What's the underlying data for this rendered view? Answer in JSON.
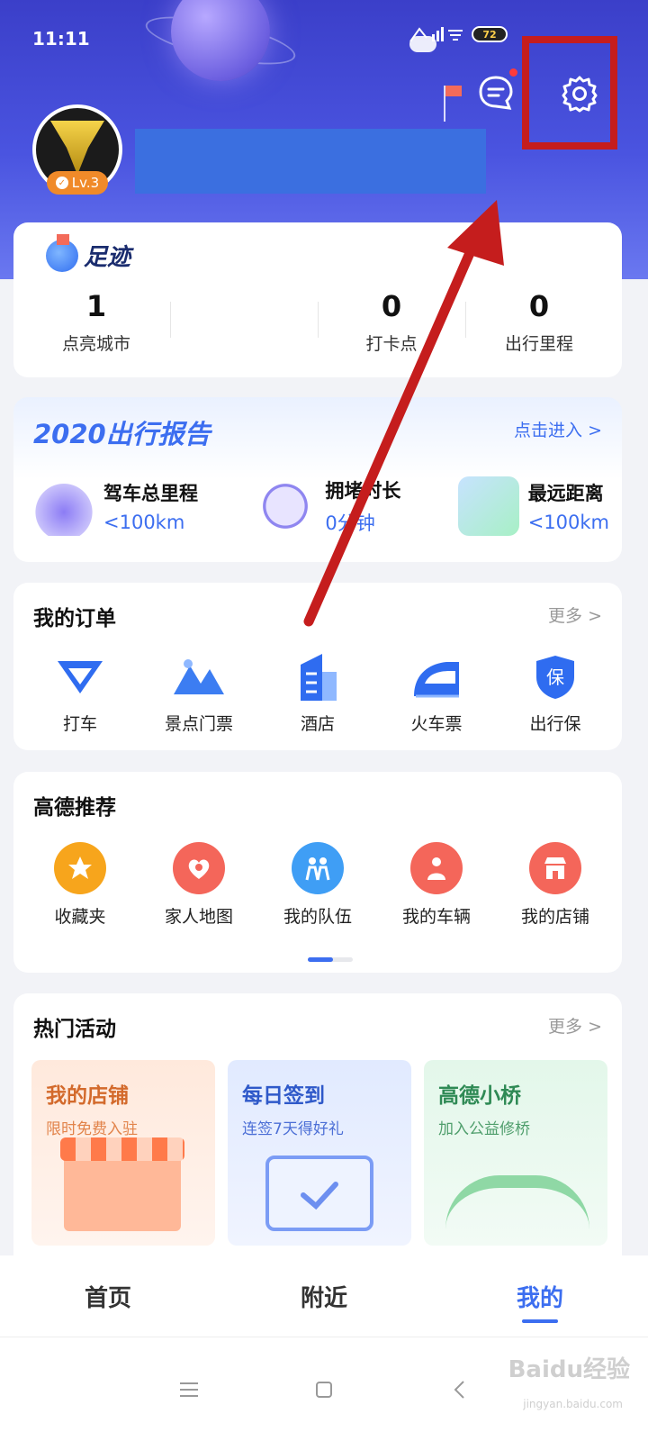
{
  "status_bar": {
    "time": "11:11",
    "battery": "72",
    "signal": "HD 4G"
  },
  "profile": {
    "level": "Lv.3"
  },
  "footprint": {
    "title": "足迹",
    "stats": [
      {
        "value": "1",
        "label": "点亮城市"
      },
      {
        "value": "0",
        "label": "打卡点"
      },
      {
        "value": "0",
        "label": "出行里程"
      }
    ]
  },
  "report": {
    "title": "2020出行报告",
    "link": "点击进入 >",
    "items": [
      {
        "title": "驾车总里程",
        "value": "<100km"
      },
      {
        "title": "拥堵时长",
        "value": "0分钟"
      },
      {
        "title": "最远距离",
        "value": "<100km"
      }
    ]
  },
  "orders": {
    "title": "我的订单",
    "more": "更多 >",
    "items": [
      {
        "label": "打车",
        "icon": "taxi-icon"
      },
      {
        "label": "景点门票",
        "icon": "mountain-icon"
      },
      {
        "label": "酒店",
        "icon": "hotel-icon"
      },
      {
        "label": "火车票",
        "icon": "train-icon"
      },
      {
        "label": "出行保",
        "icon": "shield-icon"
      }
    ]
  },
  "recommend": {
    "title": "高德推荐",
    "items": [
      {
        "label": "收藏夹",
        "icon": "star-icon",
        "color": "#f7a51c"
      },
      {
        "label": "家人地图",
        "icon": "family-icon",
        "color": "#f4665a"
      },
      {
        "label": "我的队伍",
        "icon": "team-icon",
        "color": "#3f9ef5"
      },
      {
        "label": "我的车辆",
        "icon": "car-owner-icon",
        "color": "#f4665a"
      },
      {
        "label": "我的店铺",
        "icon": "shop-icon",
        "color": "#f4665a"
      }
    ]
  },
  "hot": {
    "title": "热门活动",
    "more": "更多 >",
    "cards": [
      {
        "title": "我的店铺",
        "subtitle": "限时免费入驻"
      },
      {
        "title": "每日签到",
        "subtitle": "连签7天得好礼"
      },
      {
        "title": "高德小桥",
        "subtitle": "加入公益修桥"
      }
    ]
  },
  "tabs": [
    {
      "label": "首页"
    },
    {
      "label": "附近"
    },
    {
      "label": "我的"
    }
  ],
  "watermark": {
    "main": "Baidu经验",
    "sub": "jingyan.baidu.com"
  },
  "colors": {
    "accent": "#3c6ef0",
    "highlight": "#c51d1d"
  }
}
